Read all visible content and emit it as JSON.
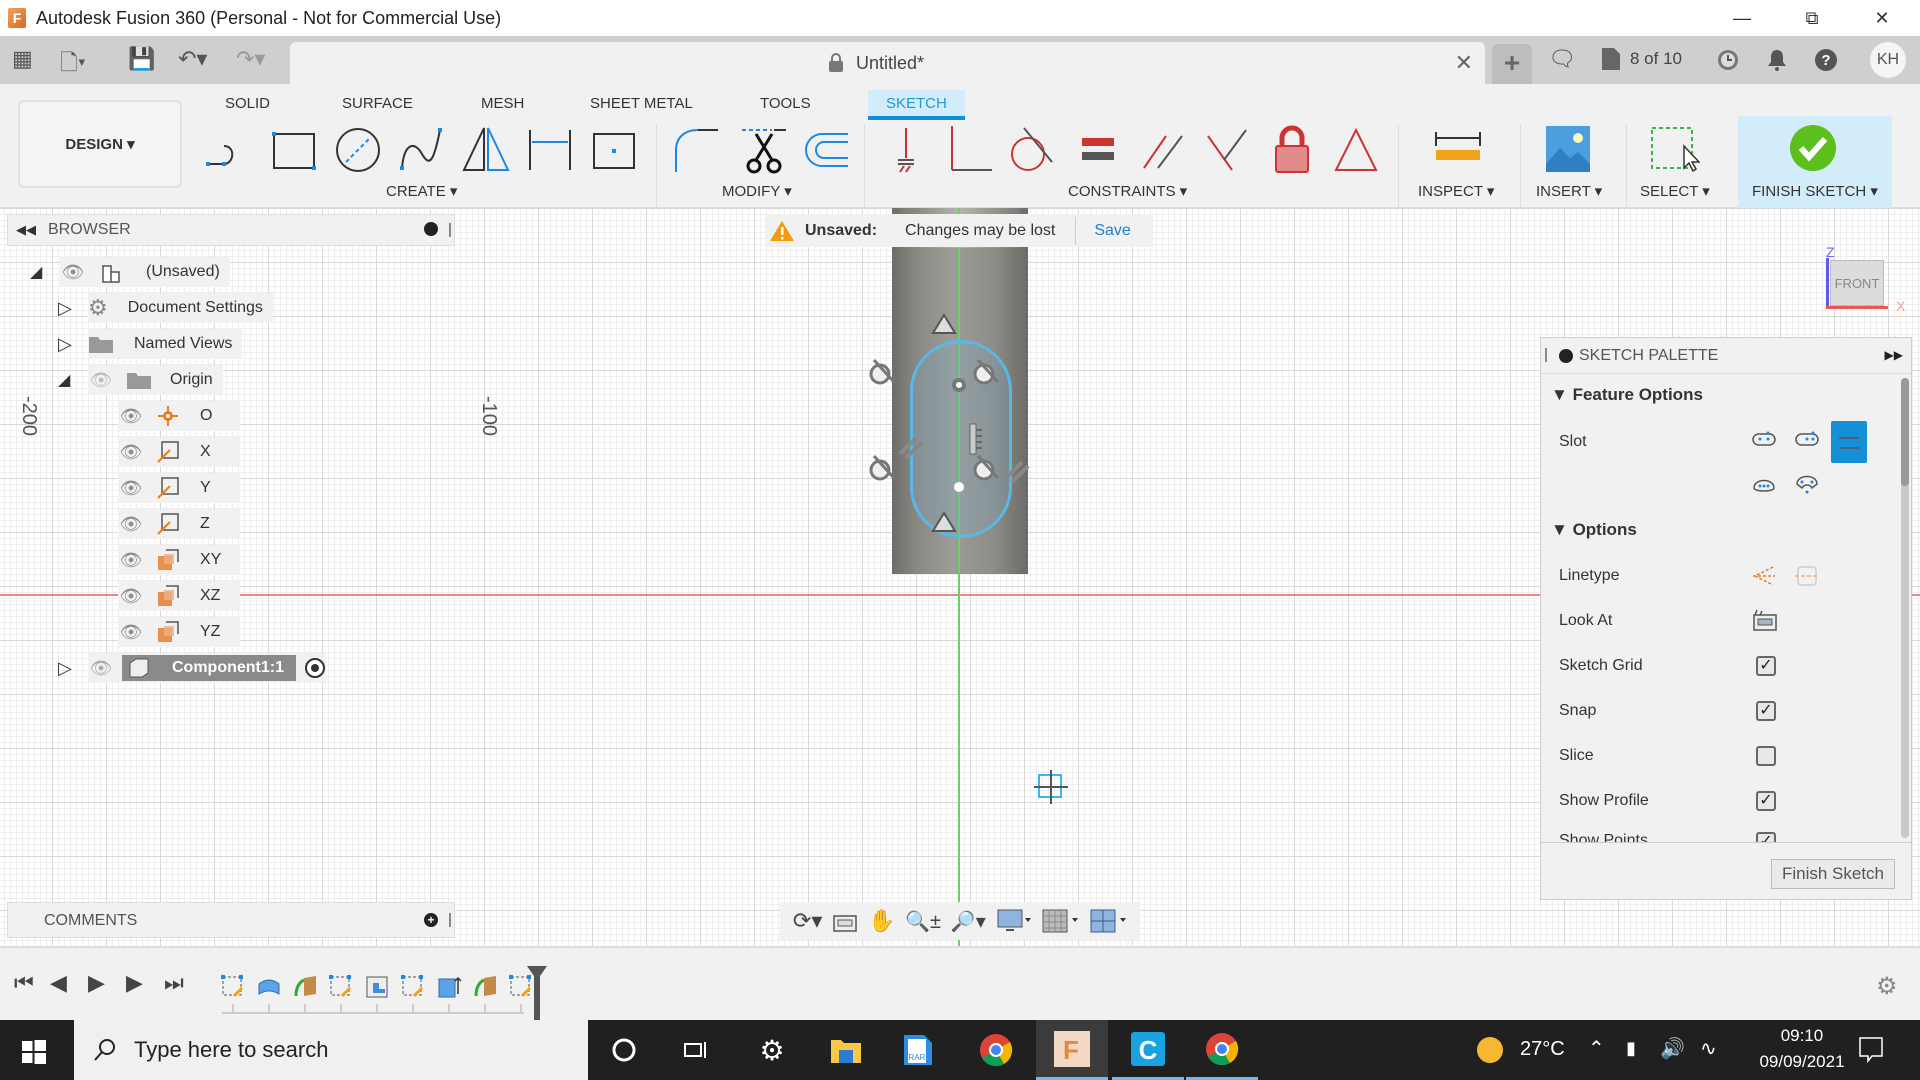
{
  "window": {
    "title": "Autodesk Fusion 360 (Personal - Not for Commercial Use)",
    "controls": [
      "minimize",
      "restore",
      "close"
    ]
  },
  "tabbar": {
    "document_title": "Untitled*",
    "jobs_status": "8 of 10",
    "avatar_initials": "KH"
  },
  "ribbon": {
    "workspace": "DESIGN",
    "tabs": [
      "SOLID",
      "SURFACE",
      "MESH",
      "SHEET METAL",
      "TOOLS",
      "SKETCH"
    ],
    "active_tab": "SKETCH",
    "groups": {
      "create": "CREATE",
      "modify": "MODIFY",
      "constraints": "CONSTRAINTS",
      "inspect": "INSPECT",
      "insert": "INSERT",
      "select": "SELECT",
      "finish": "FINISH SKETCH"
    },
    "accent_color": "#0e8fd6",
    "finish_color": "#5cbf1c"
  },
  "notification": {
    "label": "Unsaved:",
    "message": "Changes may be lost",
    "action": "Save"
  },
  "browser": {
    "title": "BROWSER",
    "root": "(Unsaved)",
    "items": [
      {
        "label": "Document Settings"
      },
      {
        "label": "Named Views"
      },
      {
        "label": "Origin"
      }
    ],
    "origin_children": [
      "O",
      "X",
      "Y",
      "Z",
      "XY",
      "XZ",
      "YZ"
    ],
    "component": "Component1:1"
  },
  "viewport": {
    "axis_labels": [
      "-200",
      "-100"
    ],
    "viewcube_face": "FRONT",
    "viewcube_axes": [
      "Z",
      "X"
    ]
  },
  "sketch_palette": {
    "title": "SKETCH PALETTE",
    "feature_options_header": "Feature Options",
    "slot_label": "Slot",
    "options_header": "Options",
    "options": [
      {
        "label": "Linetype",
        "type": "icons"
      },
      {
        "label": "Look At",
        "type": "icon"
      },
      {
        "label": "Sketch Grid",
        "checked": true
      },
      {
        "label": "Snap",
        "checked": true
      },
      {
        "label": "Slice",
        "checked": false
      },
      {
        "label": "Show Profile",
        "checked": true
      },
      {
        "label": "Show Points",
        "checked": true
      }
    ],
    "finish_button": "Finish Sketch"
  },
  "comments": {
    "title": "COMMENTS"
  },
  "taskbar": {
    "search_placeholder": "Type here to search",
    "weather": "27°C",
    "time": "09:10",
    "date": "09/09/2021"
  }
}
